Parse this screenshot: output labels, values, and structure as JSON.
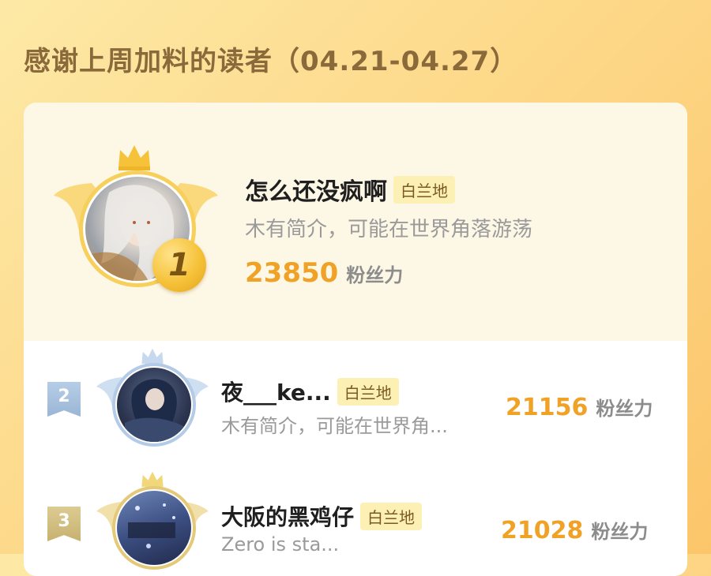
{
  "header": {
    "title": "感谢上周加料的读者（04.21-04.27）"
  },
  "colors": {
    "accent": "#f0a226",
    "tag_bg": "#fdf0b5",
    "gold": "#f6c23a",
    "silver": "#a8c2de",
    "bronze": "#d4c080"
  },
  "ranking": {
    "first": {
      "rank": "1",
      "name": "怎么还没疯啊",
      "tag": "白兰地",
      "bio": "木有简介，可能在世界角落游荡",
      "fans": "23850",
      "fans_unit": "粉丝力"
    },
    "rows": [
      {
        "rank": "2",
        "name": "夜___ke...",
        "tag": "白兰地",
        "bio": "木有简介，可能在世界角...",
        "fans": "21156",
        "fans_unit": "粉丝力"
      },
      {
        "rank": "3",
        "name": "大阪的黑鸡仔",
        "tag": "白兰地",
        "bio": "Zero is sta...",
        "fans": "21028",
        "fans_unit": "粉丝力"
      }
    ]
  },
  "icons": {
    "crown": "crown-icon",
    "wings": "wings-icon",
    "rank_badge": "rank-badge-icon"
  }
}
